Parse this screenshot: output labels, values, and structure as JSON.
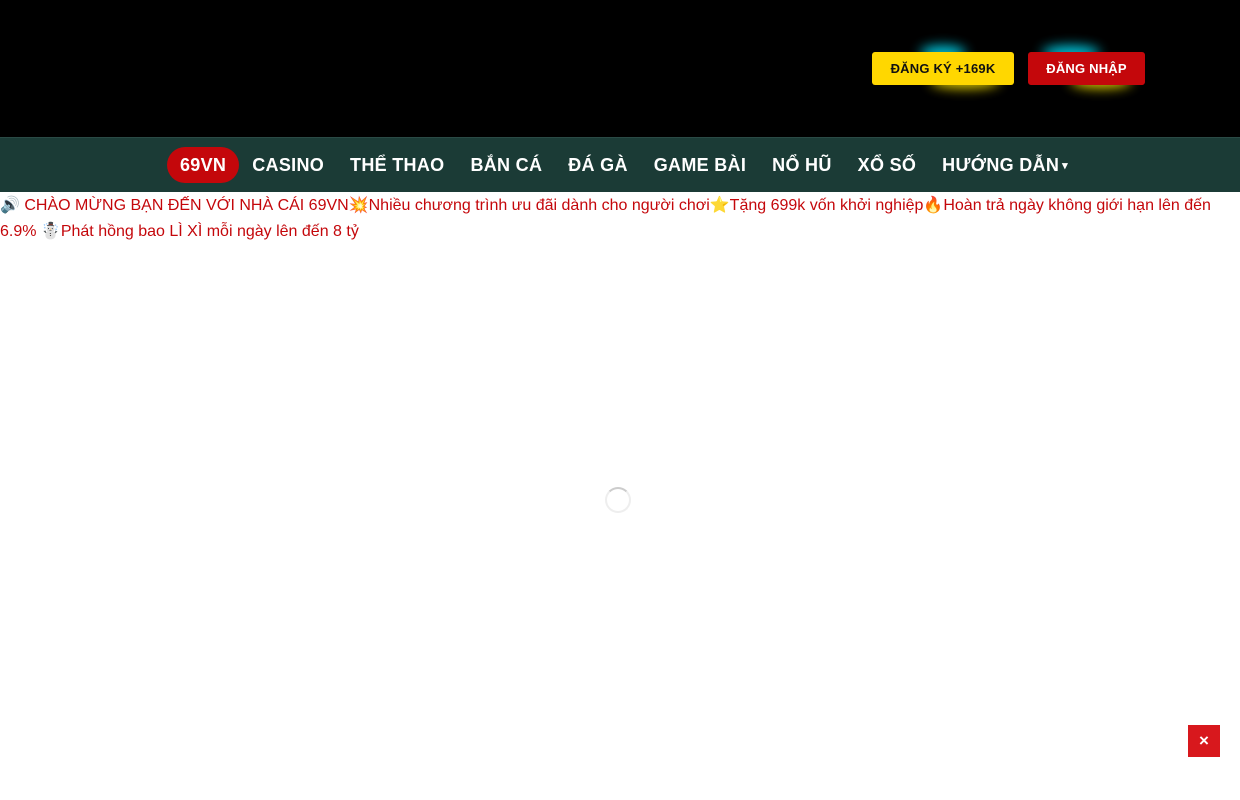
{
  "header": {
    "register_label": "ĐĂNG KÝ +169K",
    "login_label": "ĐĂNG NHẬP",
    "colors": {
      "background": "#000000",
      "register_bg": "#ffd700",
      "login_bg": "#c4070b",
      "glow_cyan": "#00e5ff",
      "glow_yellow": "#ffea00"
    }
  },
  "nav": {
    "items": [
      {
        "label": "69VN",
        "active": true
      },
      {
        "label": "CASINO"
      },
      {
        "label": "THỂ THAO"
      },
      {
        "label": "BẮN CÁ"
      },
      {
        "label": "ĐÁ GÀ"
      },
      {
        "label": "GAME BÀI"
      },
      {
        "label": "NỔ HŨ"
      },
      {
        "label": "XỔ SỐ"
      },
      {
        "label": "HƯỚNG DẪN",
        "icon": "chevron-down-icon"
      }
    ],
    "colors": {
      "background": "#1b3b36",
      "active_bg": "#c4070b"
    }
  },
  "announcement": {
    "icon": "speaker-icon",
    "text": "CHÀO MỪNG BẠN ĐẾN VỚI NHÀ CÁI 69VN💥Nhiều chương trình ưu đãi dành cho người chơi⭐Tặng 699k vốn khởi nghiệp🔥Hoàn trả ngày không giới hạn lên đến 6.9% ☃️Phát hồng bao LÌ XÌ mỗi ngày lên đến 8 tỷ",
    "color": "#c4070b"
  },
  "loader": {
    "icon": "loading-spinner-icon"
  },
  "close_button": {
    "label": "×",
    "color": "#d8181d"
  }
}
